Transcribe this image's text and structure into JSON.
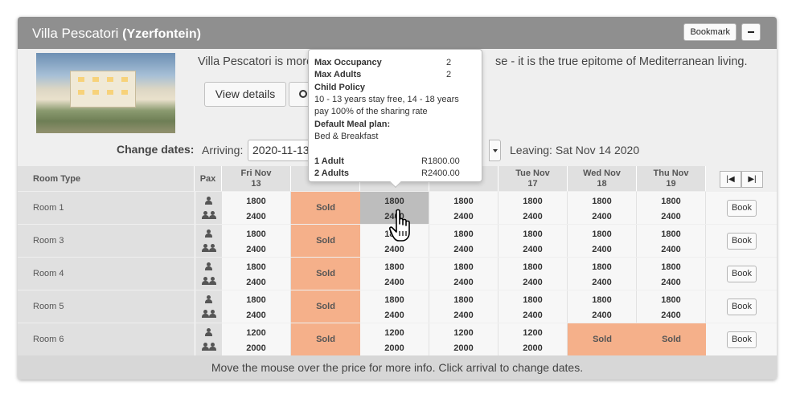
{
  "header": {
    "name": "Villa Pescatori",
    "location_open": "(",
    "location": "Yzerfontein",
    "location_close": ")",
    "bookmark_label": "Bookmark",
    "minimize_label": "−"
  },
  "intro": {
    "description_left": "Villa Pescatori is more",
    "description_right": "se - it is the true epitome of Mediterranean living.",
    "view_details_label": "View details"
  },
  "dates": {
    "change_label": "Change dates:",
    "arriving_label": "Arriving:",
    "arriving_value": "2020-11-13",
    "leaving_label": "Leaving: Sat Nov 14 2020"
  },
  "table": {
    "room_type_label": "Room Type",
    "pax_label": "Pax",
    "days": [
      {
        "line1": "Fri Nov",
        "line2": "13"
      },
      {
        "line1": "",
        "line2": ""
      },
      {
        "line1": "",
        "line2": ""
      },
      {
        "line1": "",
        "line2": ""
      },
      {
        "line1": "Tue Nov",
        "line2": "17"
      },
      {
        "line1": "Wed Nov",
        "line2": "18"
      },
      {
        "line1": "Thu Nov",
        "line2": "19"
      }
    ],
    "prev_label": "|◀",
    "next_label": "▶|",
    "book_label": "Book",
    "sold_label": "Sold",
    "rooms": [
      {
        "name": "Room 1",
        "cells": [
          [
            "1800",
            "2400"
          ],
          "Sold",
          [
            "1800",
            "2400"
          ],
          [
            "1800",
            "2400"
          ],
          [
            "1800",
            "2400"
          ],
          [
            "1800",
            "2400"
          ],
          [
            "1800",
            "2400"
          ]
        ]
      },
      {
        "name": "Room 3",
        "cells": [
          [
            "1800",
            "2400"
          ],
          "Sold",
          [
            "1800",
            "2400"
          ],
          [
            "1800",
            "2400"
          ],
          [
            "1800",
            "2400"
          ],
          [
            "1800",
            "2400"
          ],
          [
            "1800",
            "2400"
          ]
        ]
      },
      {
        "name": "Room 4",
        "cells": [
          [
            "1800",
            "2400"
          ],
          "Sold",
          [
            "1800",
            "2400"
          ],
          [
            "1800",
            "2400"
          ],
          [
            "1800",
            "2400"
          ],
          [
            "1800",
            "2400"
          ],
          [
            "1800",
            "2400"
          ]
        ]
      },
      {
        "name": "Room 5",
        "cells": [
          [
            "1800",
            "2400"
          ],
          "Sold",
          [
            "1800",
            "2400"
          ],
          [
            "1800",
            "2400"
          ],
          [
            "1800",
            "2400"
          ],
          [
            "1800",
            "2400"
          ],
          [
            "1800",
            "2400"
          ]
        ]
      },
      {
        "name": "Room 6",
        "cells": [
          [
            "1200",
            "2000"
          ],
          "Sold",
          [
            "1200",
            "2000"
          ],
          [
            "1200",
            "2000"
          ],
          [
            "1200",
            "2000"
          ],
          "Sold",
          "Sold"
        ]
      }
    ]
  },
  "tooltip": {
    "max_occupancy_label": "Max Occupancy",
    "max_occupancy_value": "2",
    "max_adults_label": "Max Adults",
    "max_adults_value": "2",
    "child_policy_label": "Child Policy",
    "child_policy_line1": " 10 - 13 years stay free, 14 - 18 years",
    "child_policy_line2": "pay 100% of the sharing rate",
    "meal_plan_label": "Default Meal plan:",
    "meal_plan_value": " Bed & Breakfast",
    "adult1_label": "1 Adult",
    "adult1_value": "R1800.00",
    "adult2_label": "2 Adults",
    "adult2_value": "R2400.00"
  },
  "footer": {
    "hint": "Move the mouse over the price for more info. Click arrival to change dates."
  },
  "colors": {
    "title_bar": "#8f8f8f",
    "sold": "#f5b08a",
    "hover_cell": "#bdbdbd"
  }
}
